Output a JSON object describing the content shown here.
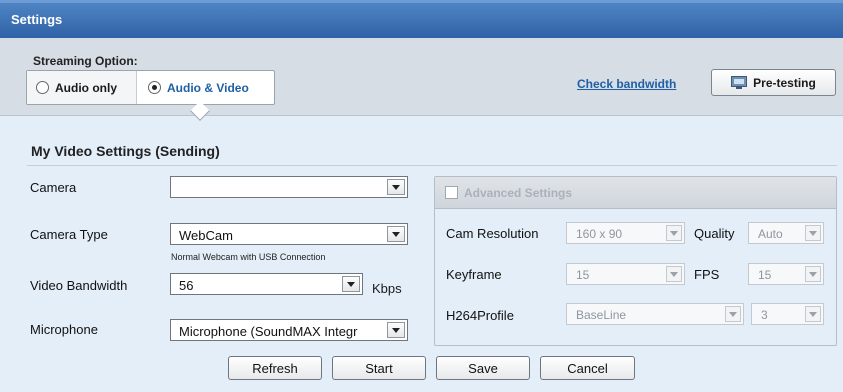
{
  "window": {
    "title": "Settings"
  },
  "streaming": {
    "label": "Streaming Option:",
    "options": [
      {
        "label": "Audio only",
        "selected": false
      },
      {
        "label": "Audio & Video",
        "selected": true
      }
    ],
    "check_bandwidth": "Check bandwidth",
    "pretesting": "Pre-testing"
  },
  "video": {
    "section_title": "My Video Settings (Sending)",
    "camera": {
      "label": "Camera",
      "value": ""
    },
    "camera_type": {
      "label": "Camera Type",
      "value": "WebCam",
      "hint": "Normal Webcam with USB Connection"
    },
    "bandwidth": {
      "label": "Video Bandwidth",
      "value": "56",
      "unit": "Kbps"
    },
    "microphone": {
      "label": "Microphone",
      "value": "Microphone (SoundMAX Integr"
    }
  },
  "advanced": {
    "title": "Advanced Settings",
    "enabled": false,
    "cam_resolution": {
      "label": "Cam Resolution",
      "value": "160 x 90"
    },
    "quality": {
      "label": "Quality",
      "value": "Auto"
    },
    "keyframe": {
      "label": "Keyframe",
      "value": "15"
    },
    "fps": {
      "label": "FPS",
      "value": "15"
    },
    "h264profile": {
      "label": "H264Profile",
      "value": "BaseLine",
      "level": "3"
    }
  },
  "buttons": {
    "refresh": "Refresh",
    "start": "Start",
    "save": "Save",
    "cancel": "Cancel"
  },
  "colors": {
    "title_bar": "#3a6db0",
    "link": "#1f5fa6",
    "panel_bg": "#e4eef8",
    "band_bg": "#d7dde4"
  }
}
